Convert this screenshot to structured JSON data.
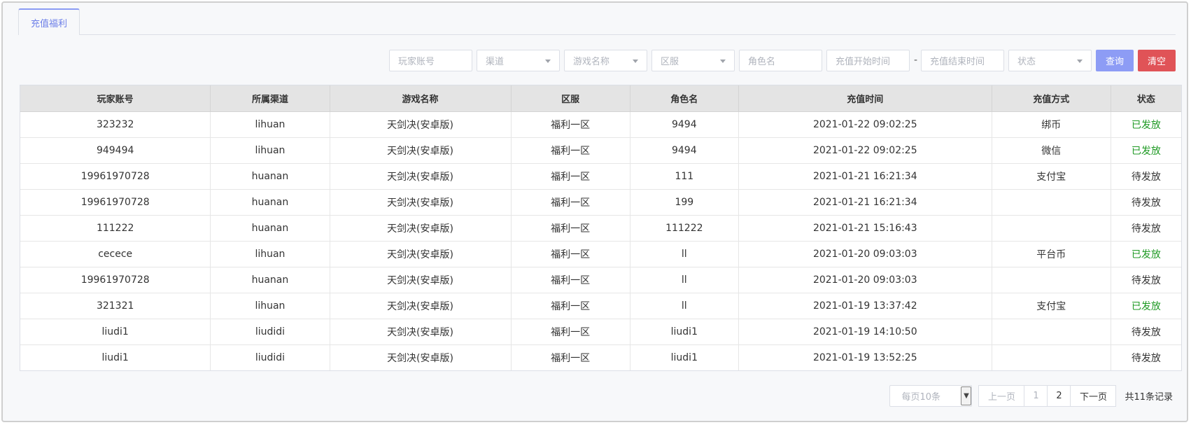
{
  "tabs": [
    {
      "label": "充值福利"
    }
  ],
  "filters": {
    "player_account": "玩家账号",
    "channel": "渠道",
    "game_name": "游戏名称",
    "server": "区服",
    "role_name": "角色名",
    "start_time": "充值开始时间",
    "separator": "-",
    "end_time": "充值结束时间",
    "status": "状态",
    "query_label": "查询",
    "clear_label": "清空"
  },
  "table": {
    "headers": [
      "玩家账号",
      "所属渠道",
      "游戏名称",
      "区服",
      "角色名",
      "充值时间",
      "充值方式",
      "状态"
    ],
    "rows": [
      [
        "323232",
        "lihuan",
        "天剑决(安卓版)",
        "福利一区",
        "9494",
        "2021-01-22 09:02:25",
        "绑币",
        "已发放"
      ],
      [
        "949494",
        "lihuan",
        "天剑决(安卓版)",
        "福利一区",
        "9494",
        "2021-01-22 09:02:25",
        "微信",
        "已发放"
      ],
      [
        "19961970728",
        "huanan",
        "天剑决(安卓版)",
        "福利一区",
        "111",
        "2021-01-21 16:21:34",
        "支付宝",
        "待发放"
      ],
      [
        "19961970728",
        "huanan",
        "天剑决(安卓版)",
        "福利一区",
        "199",
        "2021-01-21 16:21:34",
        "",
        "待发放"
      ],
      [
        "111222",
        "huanan",
        "天剑决(安卓版)",
        "福利一区",
        "111222",
        "2021-01-21 15:16:43",
        "",
        "待发放"
      ],
      [
        "cecece",
        "lihuan",
        "天剑决(安卓版)",
        "福利一区",
        "ll",
        "2021-01-20 09:03:03",
        "平台币",
        "已发放"
      ],
      [
        "19961970728",
        "huanan",
        "天剑决(安卓版)",
        "福利一区",
        "ll",
        "2021-01-20 09:03:03",
        "",
        "待发放"
      ],
      [
        "321321",
        "lihuan",
        "天剑决(安卓版)",
        "福利一区",
        "ll",
        "2021-01-19 13:37:42",
        "支付宝",
        "已发放"
      ],
      [
        "liudi1",
        "liudidi",
        "天剑决(安卓版)",
        "福利一区",
        "liudi1",
        "2021-01-19 14:10:50",
        "",
        "待发放"
      ],
      [
        "liudi1",
        "liudidi",
        "天剑决(安卓版)",
        "福利一区",
        "liudi1",
        "2021-01-19 13:52:25",
        "",
        "待发放"
      ]
    ]
  },
  "status_colors": {
    "已发放": "#1f9a24",
    "待发放": "#333333"
  },
  "pagination": {
    "page_size": "每页10条",
    "prev_label": "上一页",
    "pages": [
      "1",
      "2"
    ],
    "next_label": "下一页",
    "total": "共11条记录"
  }
}
